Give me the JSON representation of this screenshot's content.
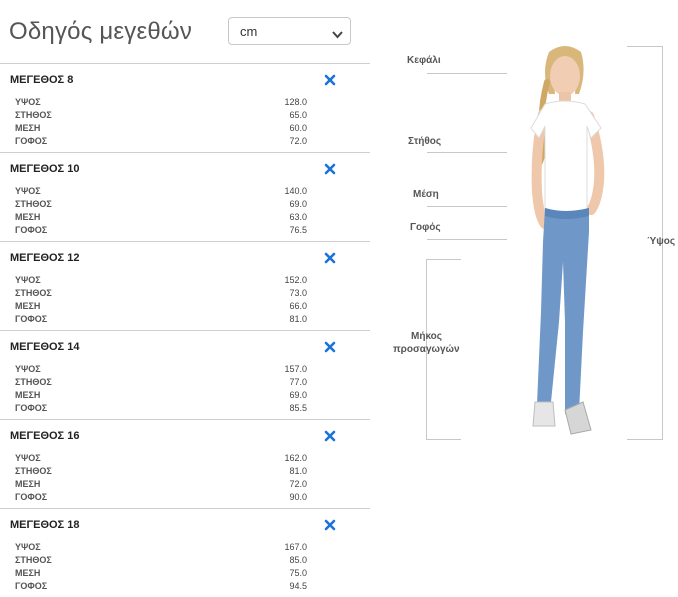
{
  "header": {
    "title": "Οδηγός μεγεθών"
  },
  "unit_select": {
    "value": "cm"
  },
  "sizes": [
    {
      "title": "ΜΕΓΕΘΟΣ 8",
      "rows": [
        {
          "label": "ΥΨΟΣ",
          "value": "128.0"
        },
        {
          "label": "ΣΤΗΘΟΣ",
          "value": "65.0"
        },
        {
          "label": "ΜΕΣΗ",
          "value": "60.0"
        },
        {
          "label": "ΓΟΦΟΣ",
          "value": "72.0"
        }
      ]
    },
    {
      "title": "ΜΕΓΕΘΟΣ 10",
      "rows": [
        {
          "label": "ΥΨΟΣ",
          "value": "140.0"
        },
        {
          "label": "ΣΤΗΘΟΣ",
          "value": "69.0"
        },
        {
          "label": "ΜΕΣΗ",
          "value": "63.0"
        },
        {
          "label": "ΓΟΦΟΣ",
          "value": "76.5"
        }
      ]
    },
    {
      "title": "ΜΕΓΕΘΟΣ 12",
      "rows": [
        {
          "label": "ΥΨΟΣ",
          "value": "152.0"
        },
        {
          "label": "ΣΤΗΘΟΣ",
          "value": "73.0"
        },
        {
          "label": "ΜΕΣΗ",
          "value": "66.0"
        },
        {
          "label": "ΓΟΦΟΣ",
          "value": "81.0"
        }
      ]
    },
    {
      "title": "ΜΕΓΕΘΟΣ 14",
      "rows": [
        {
          "label": "ΥΨΟΣ",
          "value": "157.0"
        },
        {
          "label": "ΣΤΗΘΟΣ",
          "value": "77.0"
        },
        {
          "label": "ΜΕΣΗ",
          "value": "69.0"
        },
        {
          "label": "ΓΟΦΟΣ",
          "value": "85.5"
        }
      ]
    },
    {
      "title": "ΜΕΓΕΘΟΣ 16",
      "rows": [
        {
          "label": "ΥΨΟΣ",
          "value": "162.0"
        },
        {
          "label": "ΣΤΗΘΟΣ",
          "value": "81.0"
        },
        {
          "label": "ΜΕΣΗ",
          "value": "72.0"
        },
        {
          "label": "ΓΟΦΟΣ",
          "value": "90.0"
        }
      ]
    },
    {
      "title": "ΜΕΓΕΘΟΣ 18",
      "rows": [
        {
          "label": "ΥΨΟΣ",
          "value": "167.0"
        },
        {
          "label": "ΣΤΗΘΟΣ",
          "value": "85.0"
        },
        {
          "label": "ΜΕΣΗ",
          "value": "75.0"
        },
        {
          "label": "ΓΟΦΟΣ",
          "value": "94.5"
        }
      ]
    }
  ],
  "figure": {
    "labels": {
      "head": "Κεφάλι",
      "chest": "Στήθος",
      "waist": "Μέση",
      "hips": "Γοφός",
      "inseam_1": "Μήκος",
      "inseam_2": "προσαγωγών",
      "height": "Ύψος"
    }
  },
  "colors": {
    "accent": "#1a73d9",
    "divider": "#cfcfcf",
    "text": "#333333"
  }
}
